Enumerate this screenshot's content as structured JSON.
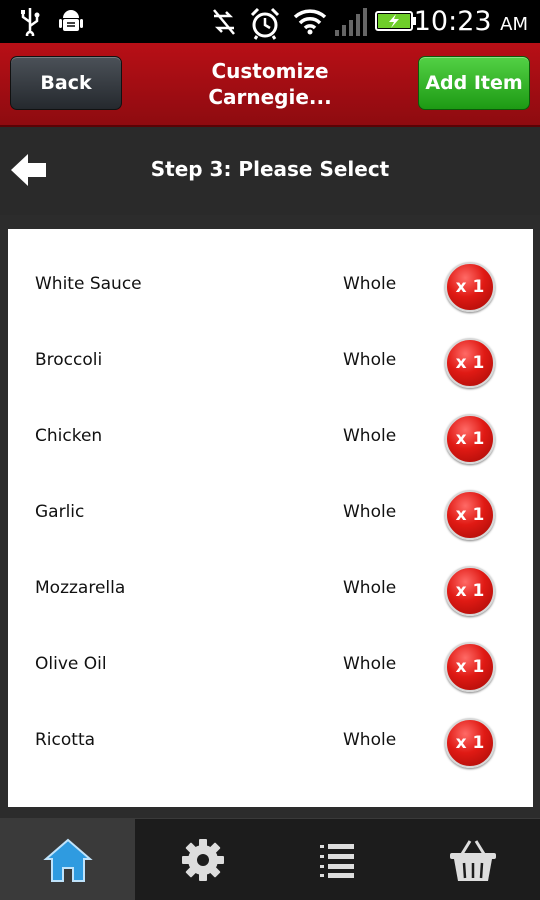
{
  "status_bar": {
    "icons": [
      "usb-icon",
      "android-debug-icon",
      "sync-off-icon",
      "alarm-icon",
      "wifi-icon",
      "signal-icon",
      "battery-charging-icon"
    ],
    "time": "10:23",
    "ampm": "AM"
  },
  "header": {
    "back_label": "Back",
    "title_line1": "Customize",
    "title_line2": "Carnegie...",
    "add_label": "Add Item",
    "brand_color": "#b80f16",
    "add_color": "#2fb424"
  },
  "step": {
    "title": "Step 3: Please Select"
  },
  "toppings": [
    {
      "name": "White Sauce",
      "portion": "Whole",
      "qty": "x 1"
    },
    {
      "name": "Broccoli",
      "portion": "Whole",
      "qty": "x 1"
    },
    {
      "name": "Chicken",
      "portion": "Whole",
      "qty": "x 1"
    },
    {
      "name": "Garlic",
      "portion": "Whole",
      "qty": "x 1"
    },
    {
      "name": "Mozzarella",
      "portion": "Whole",
      "qty": "x 1"
    },
    {
      "name": "Olive Oil",
      "portion": "Whole",
      "qty": "x 1"
    },
    {
      "name": "Ricotta",
      "portion": "Whole",
      "qty": "x 1"
    }
  ],
  "bottom_nav": [
    {
      "icon": "home-icon",
      "active": true
    },
    {
      "icon": "gear-icon",
      "active": false
    },
    {
      "icon": "list-icon",
      "active": false
    },
    {
      "icon": "basket-icon",
      "active": false
    }
  ]
}
